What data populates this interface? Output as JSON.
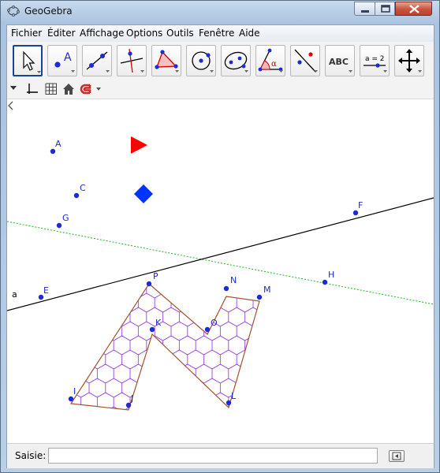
{
  "window": {
    "title": "GeoGebra"
  },
  "menu": {
    "items": [
      "Fichier",
      "Éditer",
      "Affichage",
      "Options",
      "Outils",
      "Fenêtre",
      "Aide"
    ]
  },
  "toolbar": {
    "tools": [
      {
        "icon": "move-arrow-icon",
        "selected": true
      },
      {
        "icon": "new-point-icon",
        "text": "A"
      },
      {
        "icon": "line-through-points-icon"
      },
      {
        "icon": "perpendicular-line-icon"
      },
      {
        "icon": "polygon-icon"
      },
      {
        "icon": "circle-center-point-icon"
      },
      {
        "icon": "ellipse-icon"
      },
      {
        "icon": "angle-icon",
        "text": "α"
      },
      {
        "icon": "reflect-about-line-icon"
      },
      {
        "icon": "text-icon",
        "text": "ABC"
      },
      {
        "icon": "slider-icon",
        "text": "a = 2"
      },
      {
        "icon": "move-graphics-view-icon"
      }
    ]
  },
  "stylebar": {
    "icons": [
      "stylebar-toggle-icon",
      "axes-icon",
      "grid-icon",
      "home-view-icon",
      "point-capturing-magnet-icon"
    ]
  },
  "graphics": {
    "points": [
      {
        "name": "A"
      },
      {
        "name": "C"
      },
      {
        "name": "G"
      },
      {
        "name": "E"
      },
      {
        "name": "F"
      },
      {
        "name": "H"
      },
      {
        "name": "P"
      },
      {
        "name": "N"
      },
      {
        "name": "M"
      },
      {
        "name": "K"
      },
      {
        "name": "O"
      },
      {
        "name": "I"
      },
      {
        "name": "J"
      },
      {
        "name": "L"
      }
    ],
    "line_label": "a",
    "colors": {
      "point": "#1c2bd6",
      "line": "#000000",
      "dotted_line": "#1bb81b",
      "polygon_edge": "#a0522d",
      "hex_tiling": "#8a2be2",
      "triangle": "#ff0000",
      "diamond": "#0033ff"
    }
  },
  "input_bar": {
    "label": "Saisie:",
    "value": ""
  }
}
